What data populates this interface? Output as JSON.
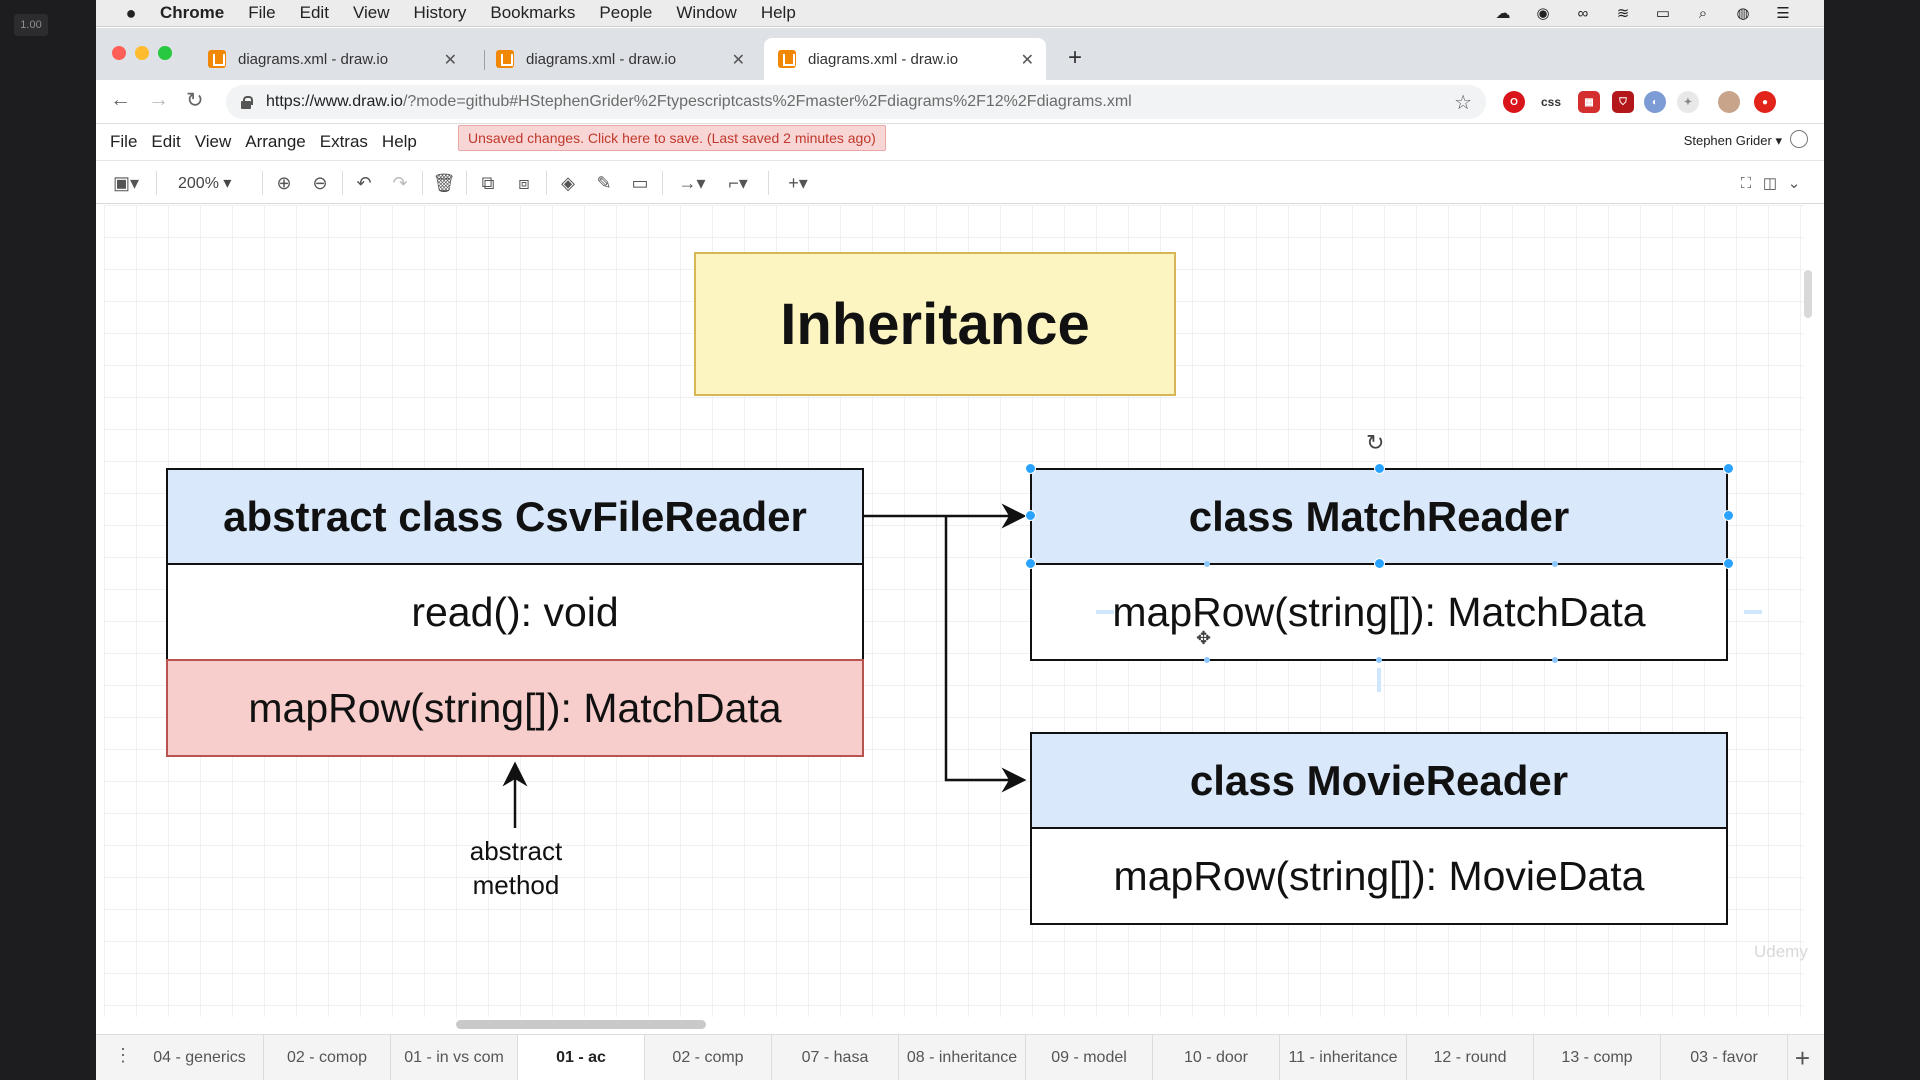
{
  "overlay": {
    "zoom_badge": "1.00"
  },
  "menubar": {
    "app": "Chrome",
    "items": [
      "File",
      "Edit",
      "View",
      "History",
      "Bookmarks",
      "People",
      "Window",
      "Help"
    ]
  },
  "browser": {
    "tabs": [
      {
        "label": "diagrams.xml - draw.io"
      },
      {
        "label": "diagrams.xml - draw.io"
      },
      {
        "label": "diagrams.xml - draw.io"
      }
    ],
    "url_host": "https://www.draw.io",
    "url_path": "/?mode=github#HStephenGrider%2Ftypescriptcasts%2Fmaster%2Fdiagrams%2F12%2Fdiagrams.xml",
    "ext_css": "css"
  },
  "drawio": {
    "menu": [
      "File",
      "Edit",
      "View",
      "Arrange",
      "Extras",
      "Help"
    ],
    "unsaved": "Unsaved changes. Click here to save. (Last saved 2 minutes ago)",
    "user": "Stephen Grider",
    "zoom": "200%"
  },
  "diagram": {
    "title": "Inheritance",
    "parent": {
      "header": "abstract class CsvFileReader",
      "method1": "read(): void",
      "method2": "mapRow(string[]): MatchData"
    },
    "annotation_line1": "abstract",
    "annotation_line2": "method",
    "child1": {
      "header": "class MatchReader",
      "method": "mapRow(string[]): MatchData"
    },
    "child2": {
      "header": "class MovieReader",
      "method": "mapRow(string[]): MovieData"
    }
  },
  "pages": [
    "04 - generics",
    "02 - comop",
    "01 - in vs com",
    "01 - ac",
    "02 - comp",
    "07 - hasa",
    "08 - inheritance",
    "09 - model",
    "10 - door",
    "11 - inheritance",
    "12 - round",
    "13 - comp",
    "03 - favor"
  ],
  "watermark": "Udemy"
}
